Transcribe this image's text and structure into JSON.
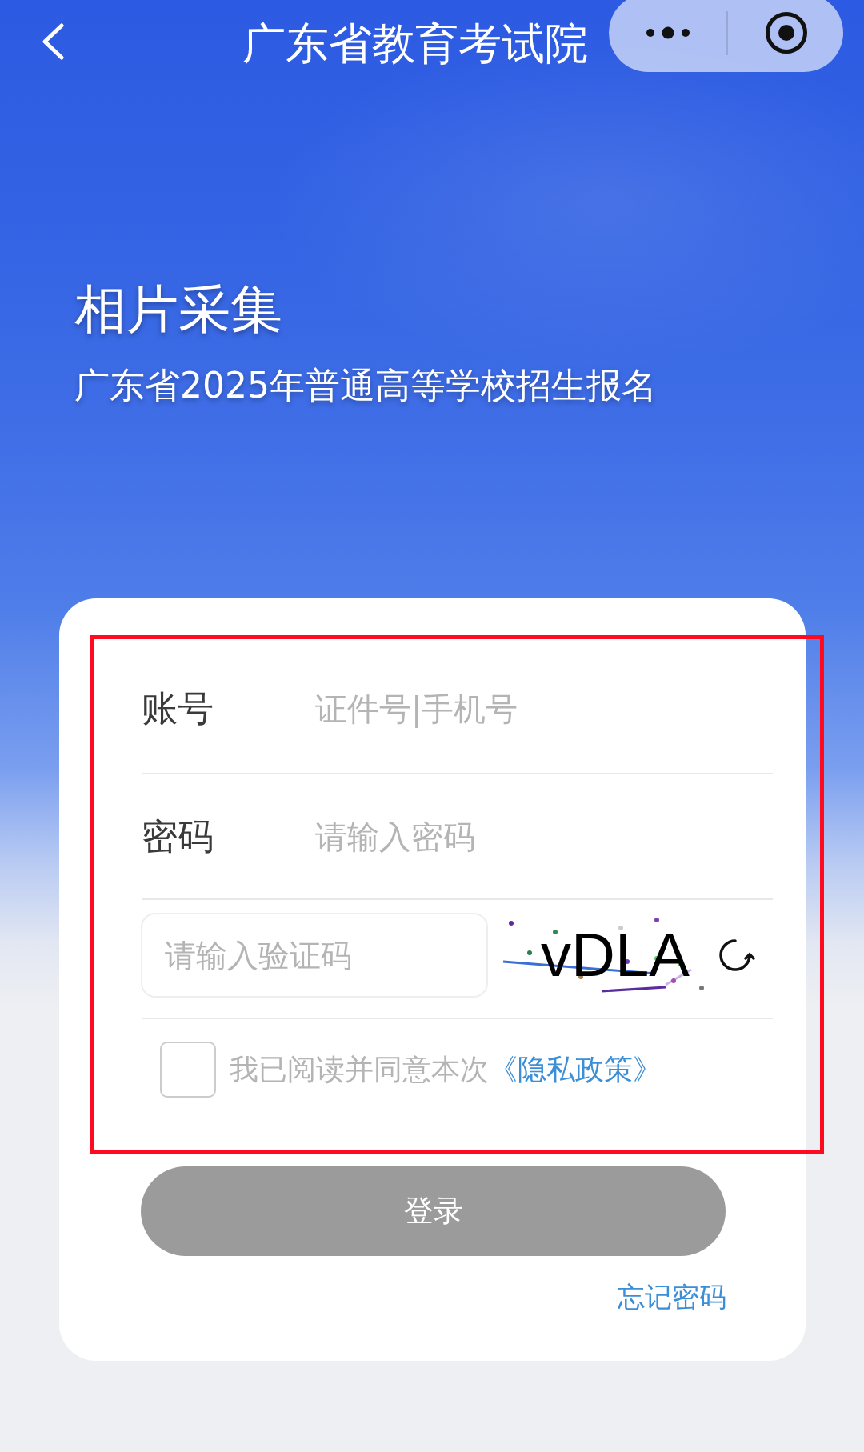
{
  "nav_bar": {
    "title": "广东省教育考试院"
  },
  "header": {
    "title": "相片采集",
    "subtitle": "广东省2025年普通高等学校招生报名"
  },
  "form": {
    "fields": [
      {
        "label": "账号",
        "placeholder": "证件号|手机号"
      },
      {
        "label": "密码",
        "placeholder": "请输入密码"
      }
    ],
    "captcha": {
      "placeholder": "请输入验证码",
      "code": "vDLA"
    },
    "agreement": {
      "checked": false,
      "text": "我已阅读并同意本次",
      "link": "《隐私政策》"
    },
    "login_button": {
      "label": "登录",
      "disabled": true
    },
    "forgot_password": "忘记密码"
  },
  "annotations": [
    {
      "kind": "rectangle"
    }
  ]
}
